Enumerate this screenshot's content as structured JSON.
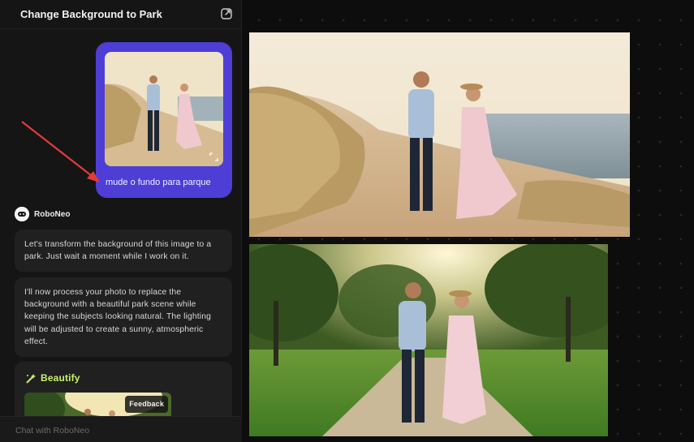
{
  "header": {
    "title": "Change Background to Park"
  },
  "user_message": {
    "text": "mude o fundo para parque"
  },
  "bot": {
    "name": "RoboNeo",
    "messages": [
      "Let's transform the background of this image to a park. Just wait a moment while I work on it.",
      "I'll now process your photo to replace the background with a beautiful park scene while keeping the subjects looking natural. The lighting will be adjusted to create a sunny, atmospheric effect."
    ],
    "tool": {
      "label": "Beautify",
      "feedback_label": "Feedback"
    }
  },
  "input": {
    "placeholder": "Chat with RoboNeo"
  },
  "colors": {
    "accent_purple": "#4e3ed6",
    "beautify_green": "#c9f26a",
    "arrow_red": "#e53a3a"
  }
}
